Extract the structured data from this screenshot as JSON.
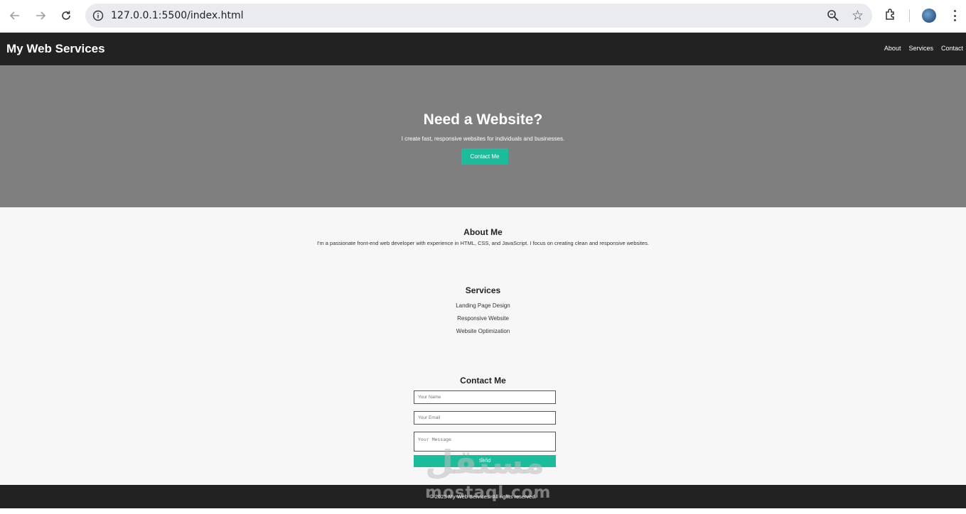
{
  "browser": {
    "url": "127.0.0.1:5500/index.html",
    "back_icon": "arrow-left-icon",
    "forward_icon": "arrow-right-icon",
    "reload_icon": "reload-icon"
  },
  "header": {
    "logo": "My Web Services",
    "nav": [
      "About",
      "Services",
      "Contact"
    ]
  },
  "hero": {
    "title": "Need a Website?",
    "subtitle": "I create fast, responsive websites for individuals and businesses.",
    "button": "Contact Me"
  },
  "about": {
    "title": "About Me",
    "text": "I'm a passionate front-end web developer with experience in HTML, CSS, and JavaScript. I focus on creating clean and responsive websites."
  },
  "services": {
    "title": "Services",
    "items": [
      "Landing Page Design",
      "Responsive Website",
      "Website Optimization"
    ]
  },
  "contact": {
    "title": "Contact Me",
    "name_placeholder": "Your Name",
    "email_placeholder": "Your Email",
    "message_placeholder": "Your Message",
    "send": "Send"
  },
  "footer": {
    "text": "© 2025 My Web Services. All rights reserved."
  },
  "watermark": {
    "arabic": "مستقل",
    "latin": "mostaql.com"
  },
  "colors": {
    "accent": "#1abc9c",
    "dark": "#222222",
    "hero_bg": "#7f7f7f",
    "page_bg": "#f7f7f7"
  }
}
